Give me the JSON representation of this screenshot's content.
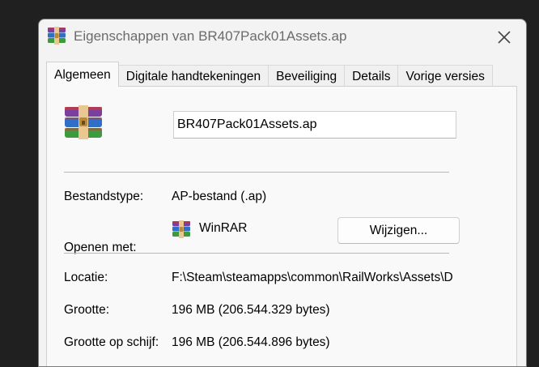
{
  "window": {
    "title": "Eigenschappen van BR407Pack01Assets.ap",
    "close_icon": "close-icon"
  },
  "tabs": [
    {
      "label": "Algemeen",
      "active": true
    },
    {
      "label": "Digitale handtekeningen",
      "active": false
    },
    {
      "label": "Beveiliging",
      "active": false
    },
    {
      "label": "Details",
      "active": false
    },
    {
      "label": "Vorige versies",
      "active": false
    }
  ],
  "general": {
    "file_icon": "winrar-archive-icon",
    "file_name": "BR407Pack01Assets.ap",
    "type_label": "Bestandstype:",
    "type_value": "AP-bestand (.ap)",
    "opens_with_label": "Openen met:",
    "opens_with_app": "WinRAR",
    "change_button": "Wijzigen...",
    "location_label": "Locatie:",
    "location_value": "F:\\Steam\\steamapps\\common\\RailWorks\\Assets\\D",
    "size_label": "Grootte:",
    "size_value": "196 MB (206.544.329 bytes)",
    "size_on_disk_label": "Grootte op schijf:",
    "size_on_disk_value": "196 MB (206.544.896 bytes)"
  },
  "colors": {
    "background": "#202020",
    "window": "#f3f3f3",
    "panel": "#f9f9f9",
    "title_text": "#6b6b6b"
  }
}
